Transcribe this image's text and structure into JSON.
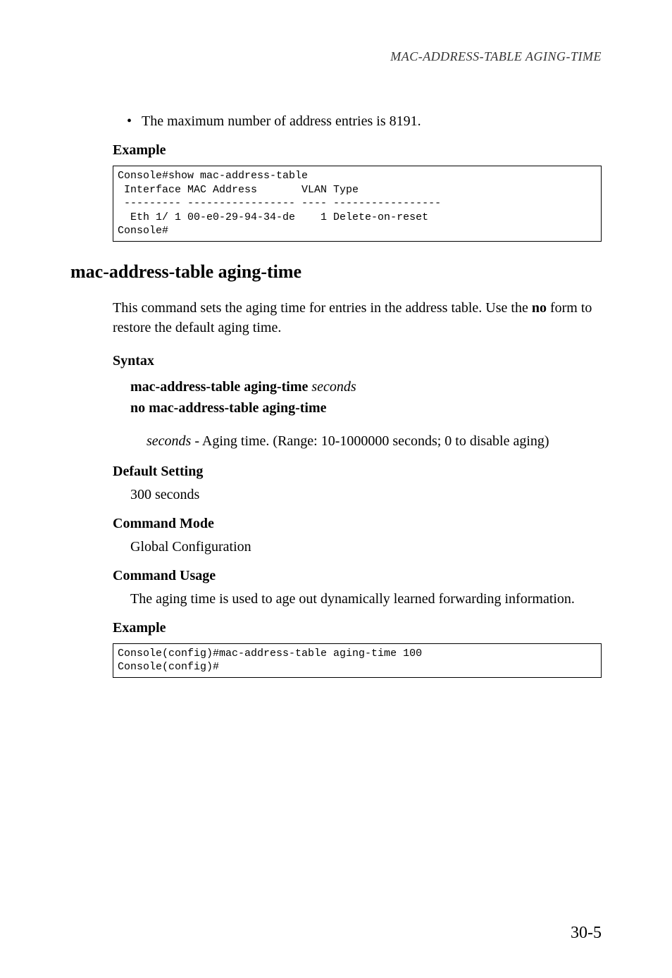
{
  "header": "MAC-ADDRESS-TABLE AGING-TIME",
  "bullet_text": "The maximum number of address entries is 8191.",
  "example1_heading": "Example",
  "example1_code": "Console#show mac-address-table\n Interface MAC Address       VLAN Type\n --------- ----------------- ---- -----------------\n  Eth 1/ 1 00-e0-29-94-34-de    1 Delete-on-reset\nConsole#",
  "command_title": "mac-address-table aging-time",
  "description_part1": "This command sets the aging time for entries in the address table. Use the ",
  "description_bold": "no",
  "description_part2": " form to restore the default aging time.",
  "syntax_heading": "Syntax",
  "syntax_line1_bold": "mac-address-table aging-time",
  "syntax_line1_italic": "seconds",
  "syntax_line2": "no mac-address-table aging-time",
  "param_italic": "seconds",
  "param_text": " - Aging time. (Range: 10-1000000 seconds; 0 to disable aging)",
  "default_heading": "Default Setting",
  "default_value": "300 seconds",
  "mode_heading": "Command Mode",
  "mode_value": "Global Configuration",
  "usage_heading": "Command Usage",
  "usage_text": "The aging time is used to age out dynamically learned forwarding information.",
  "example2_heading": "Example",
  "example2_code": "Console(config)#mac-address-table aging-time 100\nConsole(config)#",
  "page_number": "30-5"
}
